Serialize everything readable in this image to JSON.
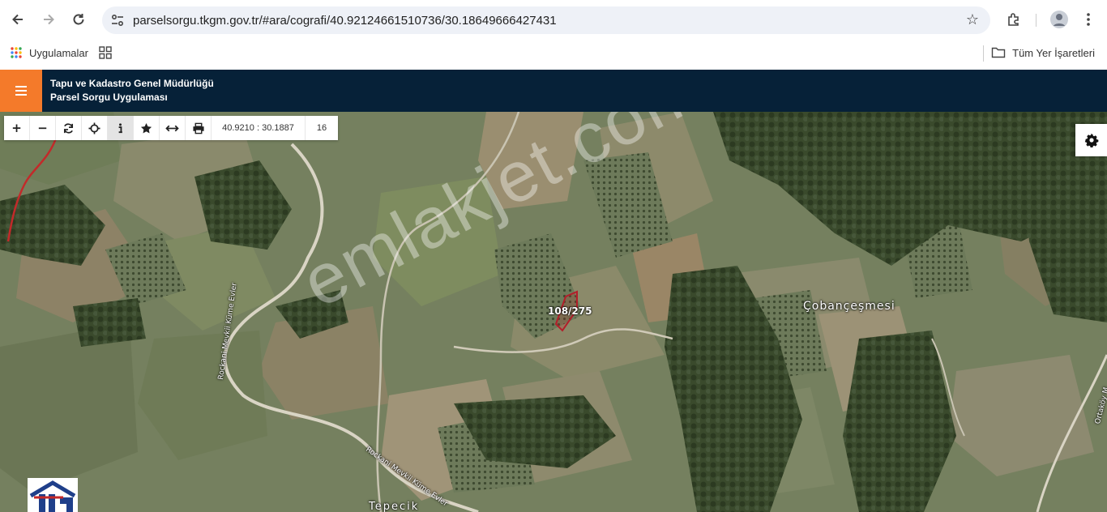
{
  "browser": {
    "url": "parselsorgu.tkgm.gov.tr/#ara/cografi/40.92124661510736/30.18649666427431",
    "bookmarks": {
      "apps_label": "Uygulamalar",
      "all_bookmarks_label": "Tüm Yer İşaretleri"
    }
  },
  "app": {
    "title_line1": "Tapu ve Kadastro Genel Müdürlüğü",
    "title_line2": "Parsel Sorgu Uygulaması",
    "accent_color": "#f47a2a",
    "header_color": "#062138"
  },
  "toolbar": {
    "coords": "40.9210 : 30.1887",
    "zoom": "16",
    "buttons": [
      "zoom-in",
      "zoom-out",
      "refresh",
      "locate",
      "info",
      "favorite",
      "measure",
      "print"
    ]
  },
  "map": {
    "parcel_label": "108/275",
    "place_labels": {
      "cobancesmesi": "Çobançeşmesi",
      "tepecik": "Tepecik",
      "road_1": "Rockani Mevkii Küme Evler",
      "road_2": "Rockani Mevkii Küme Evler",
      "road_3": "Ortaköy M"
    },
    "watermark": "emlakjet.com"
  }
}
